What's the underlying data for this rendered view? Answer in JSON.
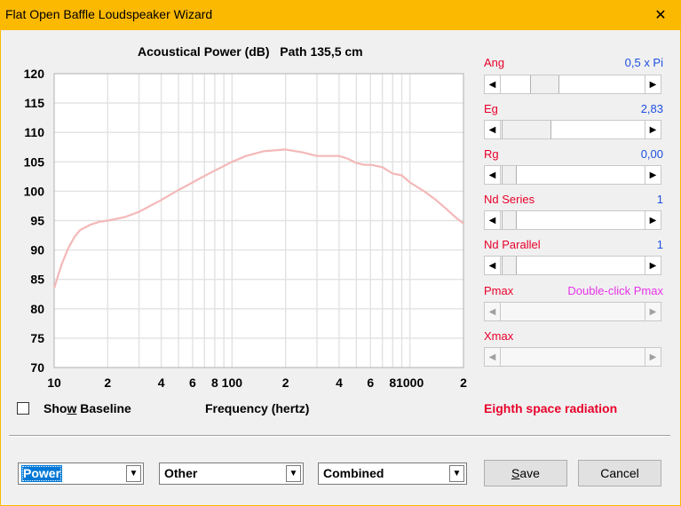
{
  "window": {
    "title": "Flat Open Baffle Loudspeaker Wizard",
    "close_icon": "✕"
  },
  "chart_data": {
    "type": "line",
    "title": "Acoustical Power (dB)   Path 135,5 cm",
    "xlabel": "Frequency (hertz)",
    "ylabel": "",
    "xscale": "log",
    "xlim": [
      10,
      2000
    ],
    "ylim": [
      70,
      120
    ],
    "yticks": [
      120,
      115,
      110,
      105,
      100,
      95,
      90,
      85,
      80,
      75,
      70
    ],
    "xticks": [
      {
        "v": 10,
        "label": "10"
      },
      {
        "v": 20,
        "label": "2"
      },
      {
        "v": 40,
        "label": "4"
      },
      {
        "v": 60,
        "label": "6"
      },
      {
        "v": 80,
        "label": "8"
      },
      {
        "v": 100,
        "label": "100"
      },
      {
        "v": 200,
        "label": "2"
      },
      {
        "v": 400,
        "label": "4"
      },
      {
        "v": 600,
        "label": "6"
      },
      {
        "v": 800,
        "label": "8"
      },
      {
        "v": 1000,
        "label": "1000"
      },
      {
        "v": 2000,
        "label": "2"
      }
    ],
    "grid": true,
    "line_color": "#f4b8b8",
    "series": [
      {
        "x": [
          10,
          11,
          12,
          13,
          14,
          16,
          18,
          20,
          25,
          30,
          40,
          50,
          60,
          70,
          80,
          100,
          120,
          150,
          200,
          250,
          300,
          350,
          400,
          450,
          500,
          550,
          600,
          700,
          800,
          900,
          1000,
          1200,
          1400,
          1600,
          1800,
          2000
        ],
        "y": [
          83.5,
          87.5,
          90.3,
          92.2,
          93.4,
          94.3,
          94.8,
          95.0,
          95.6,
          96.5,
          98.5,
          100.2,
          101.5,
          102.6,
          103.5,
          105.0,
          106.0,
          106.8,
          107.1,
          106.6,
          106.0,
          106.0,
          106.0,
          105.5,
          104.8,
          104.5,
          104.5,
          104.1,
          103.0,
          102.7,
          101.5,
          100.0,
          98.5,
          97.0,
          95.6,
          94.5
        ]
      }
    ]
  },
  "params": [
    {
      "label": "Ang",
      "value": "0,5 x Pi"
    },
    {
      "label": "Eg",
      "value": "2,83"
    },
    {
      "label": "Rg",
      "value": "0,00"
    },
    {
      "label": "Nd  Series",
      "value": "1"
    },
    {
      "label": "Nd  Parallel",
      "value": "1"
    },
    {
      "label": "Pmax",
      "value": "Double-click Pmax"
    },
    {
      "label": "Xmax",
      "value": ""
    }
  ],
  "sliders": [
    {
      "name": "ang",
      "position": 0.25
    },
    {
      "name": "eg",
      "position": 0.18
    },
    {
      "name": "rg",
      "position": 0.0
    },
    {
      "name": "nd-series",
      "position": 0.0
    },
    {
      "name": "nd-parallel",
      "position": 0.0
    }
  ],
  "arrows": {
    "left": "◀",
    "right": "▶",
    "down": "▼"
  },
  "baseline": {
    "label_pre": "Sho",
    "label_u": "w",
    "label_post": " Baseline",
    "checked": false
  },
  "radiation": "Eighth space radiation",
  "combos": {
    "mode": "Power",
    "other": "Other",
    "combined": "Combined"
  },
  "buttons": {
    "save_u": "S",
    "save_rest": "ave",
    "cancel": "Cancel"
  }
}
